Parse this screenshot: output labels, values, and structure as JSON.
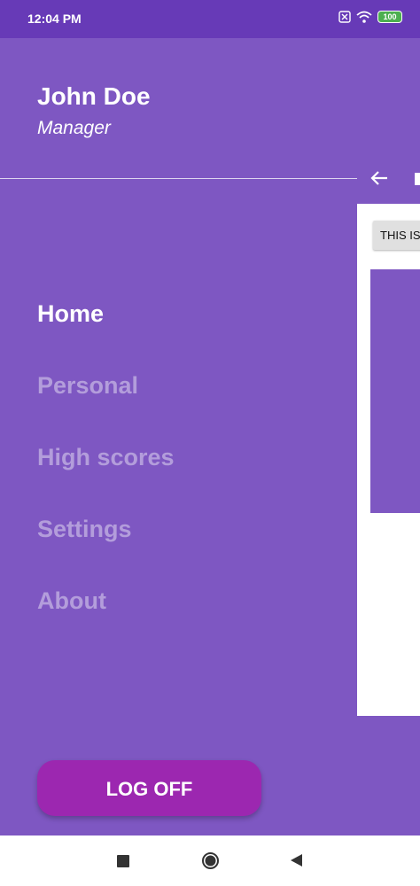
{
  "status_bar": {
    "time": "12:04 PM",
    "battery": "100"
  },
  "drawer": {
    "user_name": "John Doe",
    "user_role": "Manager",
    "menu": [
      {
        "label": "Home",
        "active": true
      },
      {
        "label": "Personal",
        "active": false
      },
      {
        "label": "High scores",
        "active": false
      },
      {
        "label": "Settings",
        "active": false
      },
      {
        "label": "About",
        "active": false
      }
    ],
    "logoff_label": "LOG OFF"
  },
  "main_screen": {
    "chip_text": "THIS IS"
  },
  "colors": {
    "primary": "#7e57c2",
    "primary_dark": "#673ab7",
    "accent": "#9c27b0",
    "inactive_text": "#b39ddb"
  },
  "icons": {
    "status": [
      "sim-off-icon",
      "wifi-icon",
      "battery-icon"
    ],
    "toolbar": [
      "back-arrow-icon"
    ],
    "nav": [
      "recents-icon",
      "home-icon",
      "back-icon"
    ]
  }
}
